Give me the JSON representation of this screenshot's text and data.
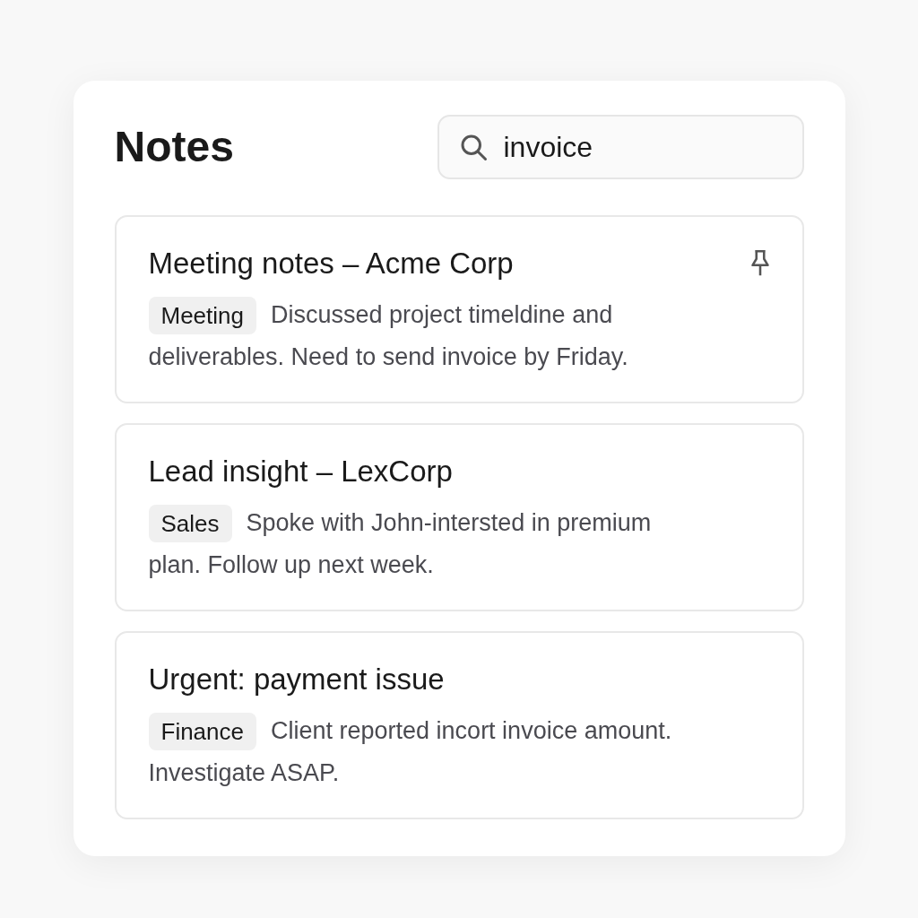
{
  "title": "Notes",
  "search": {
    "value": "invoice"
  },
  "notes": [
    {
      "title": "Meeting notes – Acme Corp",
      "pinned": true,
      "tag": "Meeting",
      "lines": [
        "Discussed project timeldine and",
        "deliverables. Need to send invoice by Friday."
      ]
    },
    {
      "title": "Lead insight – LexCorp",
      "pinned": false,
      "tag": "Sales",
      "lines": [
        "Spoke with John-intersted in premium",
        "plan. Follow up next week."
      ]
    },
    {
      "title": "Urgent: payment issue",
      "pinned": false,
      "tag": "Finance",
      "lines": [
        "Client reported incort invoice amount.",
        "Investigate ASAP."
      ]
    }
  ]
}
